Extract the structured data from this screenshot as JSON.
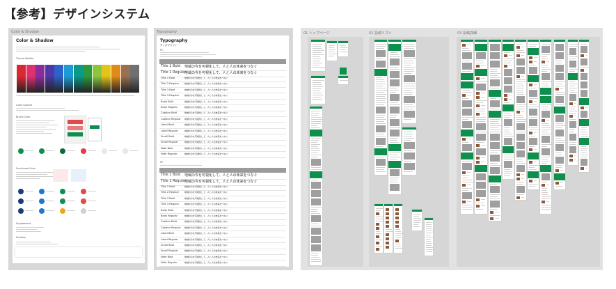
{
  "page_title": "【参考】デザインシステム",
  "boards": {
    "color_shadow": {
      "label": "Color & Shadow",
      "sheet_title": "Color & Shadow",
      "sections": [
        "Theme Palette",
        "Color System",
        "Brand Color",
        "Functional Color",
        "Supplement",
        "Shadow"
      ],
      "palette_colors": [
        "#d9282f",
        "#e0306e",
        "#8a2d9c",
        "#4c3aa8",
        "#2c62c9",
        "#1e9bd7",
        "#0a9a8a",
        "#2c9a3c",
        "#8cc63f",
        "#e7c31a",
        "#e08a1a",
        "#9a7050",
        "#707070"
      ],
      "brand_dots": [
        "#0f8f4e",
        "#0f8f4e",
        "#0b6b3a",
        "#e53a4a",
        "#e8e8e8",
        "#e8e8e8"
      ],
      "functional_dots": [
        "#1b3a7a",
        "#1a7ad0",
        "#0f8f4e",
        "#e14a4a",
        "#1b3a7a",
        "#1a7ad0",
        "#0f8f4e",
        "#e14a4a",
        "#1b3a7a",
        "#1a7ad0",
        "#f2a31a",
        "#d0d0d0"
      ]
    },
    "typography": {
      "label": "Typography",
      "sheet_title": "Typography",
      "subtitle": "タイポグラフィ",
      "section_pc": "PC",
      "section_sp": "SP",
      "rows": [
        {
          "style": "Title 1 Bold",
          "sample": "地域の今を可視化して、人と人の未来をつなぐ",
          "big": true
        },
        {
          "style": "Title 1 Regular",
          "sample": "地域の今を可視化して、人と人の未来をつなぐ",
          "big": true
        },
        {
          "style": "Title 2 Bold",
          "sample": "地域の今を可視化して、人と人の未来をつなぐ",
          "big": false
        },
        {
          "style": "Title 2 Regular",
          "sample": "地域の今を可視化して、人と人の未来をつなぐ",
          "big": false
        },
        {
          "style": "Title 3 Bold",
          "sample": "地域の今を可視化して、人と人の未来をつなぐ",
          "big": false
        },
        {
          "style": "Title 3 Regular",
          "sample": "地域の今を可視化して、人と人の未来をつなぐ",
          "big": false
        },
        {
          "style": "Body Bold",
          "sample": "地域の今を可視化して、人と人の未来をつなぐ",
          "big": false
        },
        {
          "style": "Body Regular",
          "sample": "地域の今を可視化して、人と人の未来をつなぐ",
          "big": false
        },
        {
          "style": "Caption Bold",
          "sample": "地域の今を可視化して、人と人の未来をつなぐ",
          "big": false
        },
        {
          "style": "Caption Regular",
          "sample": "地域の今を可視化して、人と人の未来をつなぐ",
          "big": false
        },
        {
          "style": "Label Bold",
          "sample": "地域の今を可視化して、人と人の未来をつなぐ",
          "big": false
        },
        {
          "style": "Label Regular",
          "sample": "地域の今を可視化して、人と人の未来をつなぐ",
          "big": false
        },
        {
          "style": "Small Bold",
          "sample": "地域の今を可視化して、人と人の未来をつなぐ",
          "big": false
        },
        {
          "style": "Small Regular",
          "sample": "地域の今を可視化して、人と人の未来をつなぐ",
          "big": false
        },
        {
          "style": "Note Bold",
          "sample": "地域の今を可視化して、人と人の未来をつなぐ",
          "big": false
        },
        {
          "style": "Note Regular",
          "sample": "地域の今を可視化して、人と人の未来をつなぐ",
          "big": false
        }
      ]
    },
    "top_page": {
      "label": "01 トップページ"
    },
    "post_list": {
      "label": "02 投稿リスト"
    },
    "post_detail": {
      "label": "03 投稿詳細"
    }
  }
}
